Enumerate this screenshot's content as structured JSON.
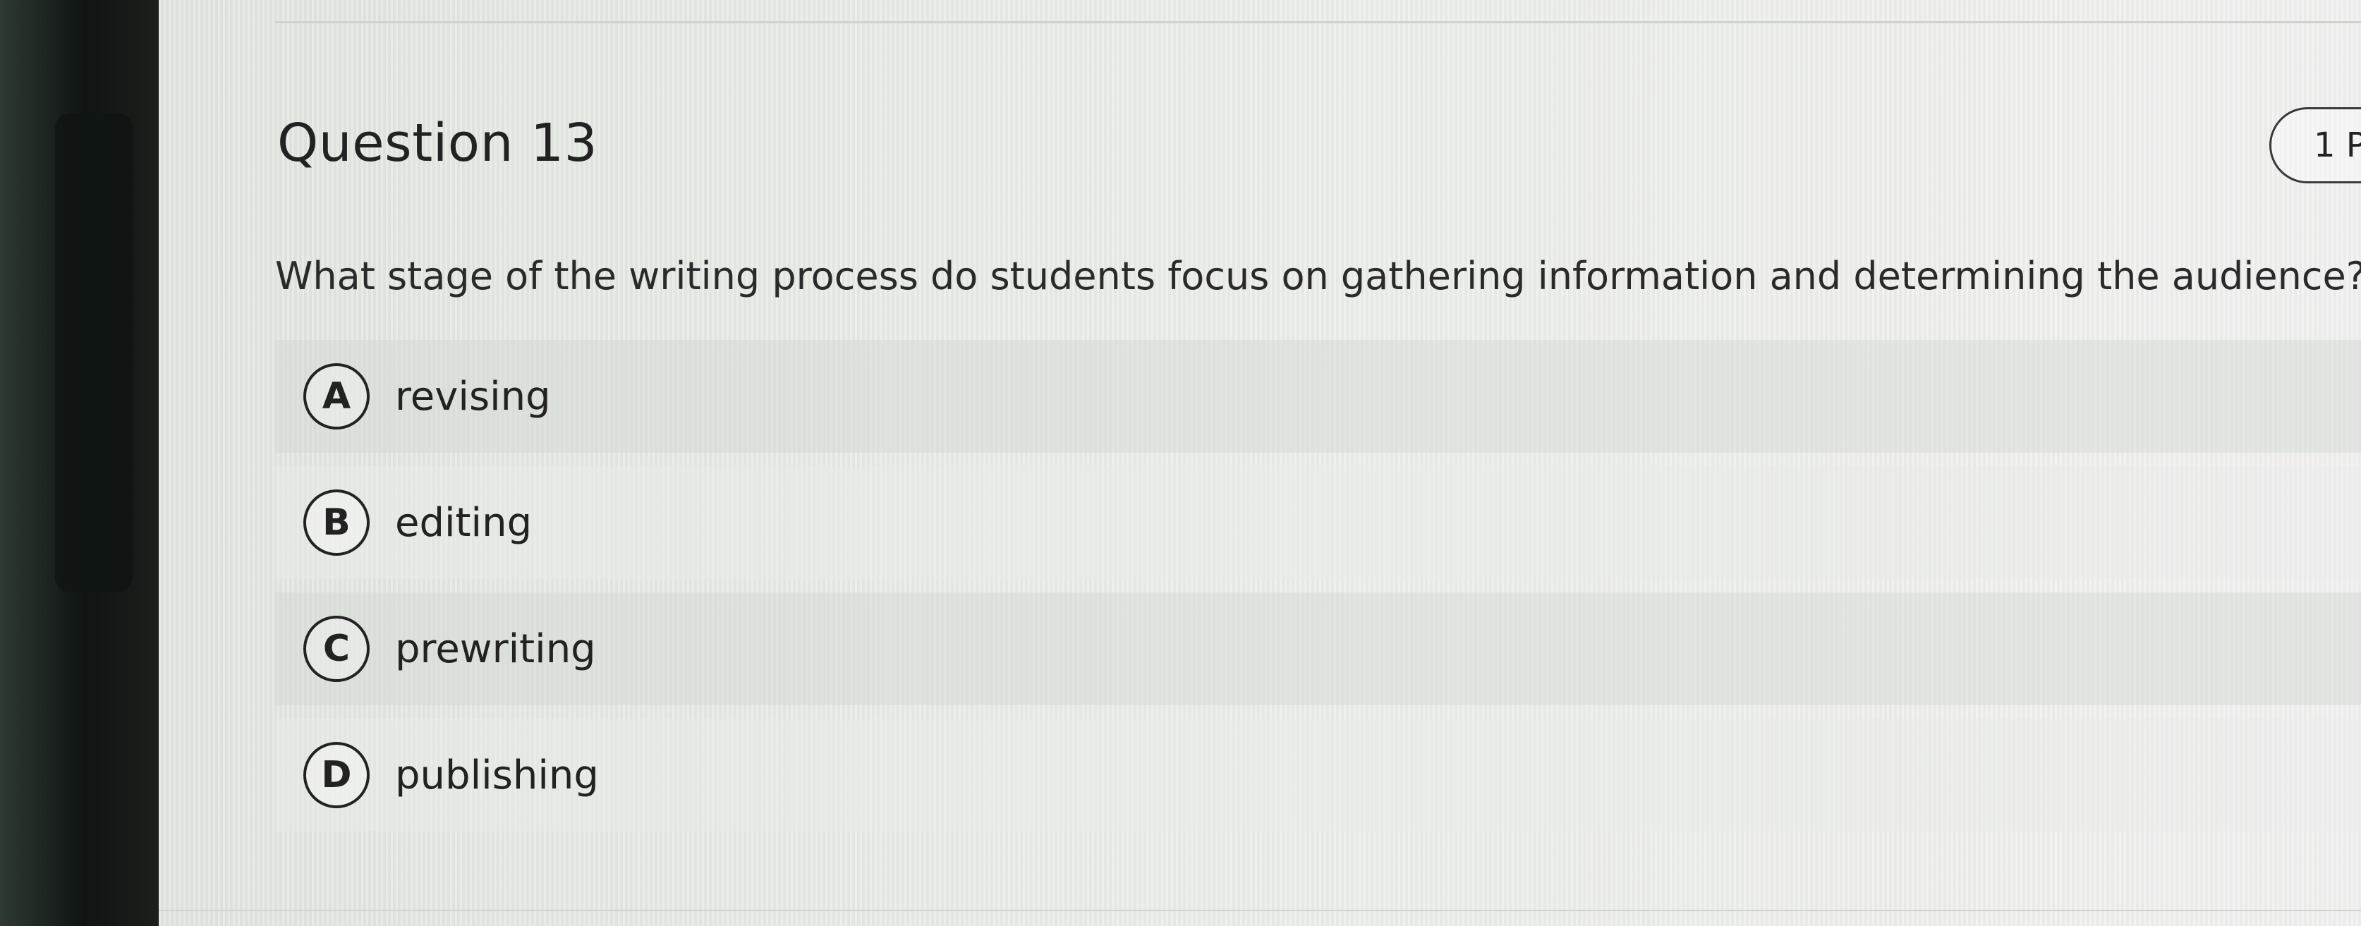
{
  "question": {
    "title": "Question 13",
    "points": "1 P",
    "text": "What stage of the writing process do students focus on gathering information and determining the audience?"
  },
  "options": [
    {
      "letter": "A",
      "label": "revising"
    },
    {
      "letter": "B",
      "label": "editing"
    },
    {
      "letter": "C",
      "label": "prewriting"
    },
    {
      "letter": "D",
      "label": "publishing"
    }
  ]
}
